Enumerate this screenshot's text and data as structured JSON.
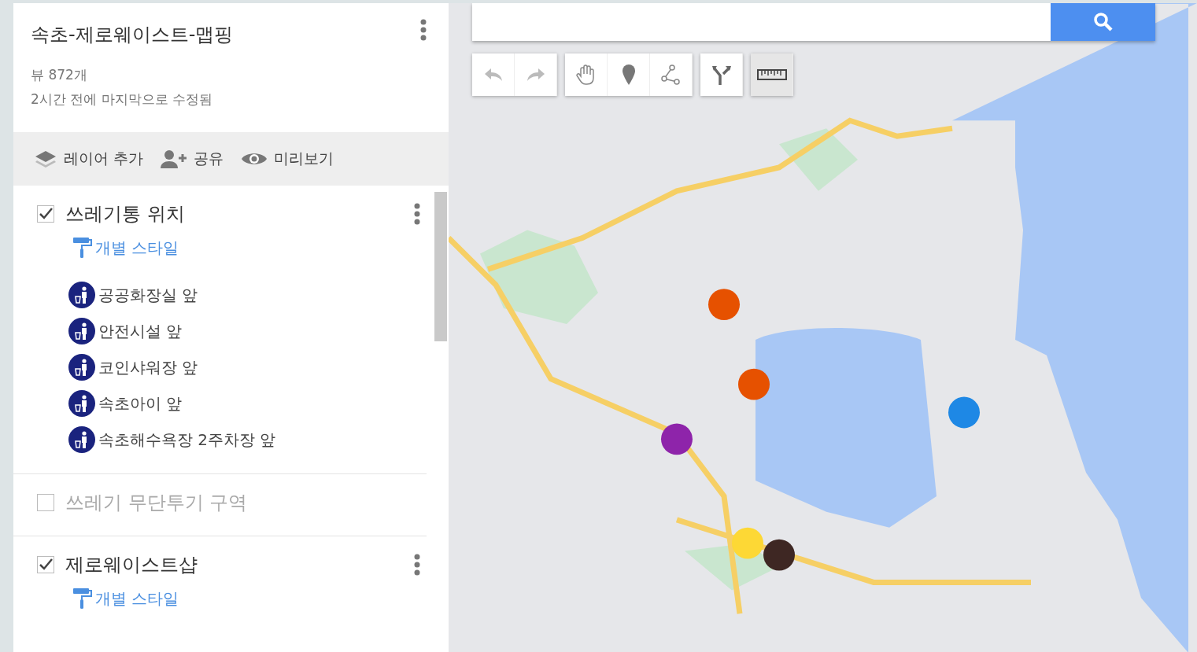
{
  "map_title": "속초-제로웨이스트-맵핑",
  "views": "뷰 872개",
  "modified": "2시간 전에 마지막으로 수정됨",
  "actions": [
    {
      "kind": "layers",
      "label": "레이어 추가"
    },
    {
      "kind": "share",
      "label": "공유"
    },
    {
      "kind": "preview",
      "label": "미리보기"
    }
  ],
  "layers": [
    {
      "name": "쓰레기통 위치",
      "checked": true,
      "style_link": "개별 스타일",
      "items": [
        "공공화장실 앞",
        "안전시설 앞",
        "코인샤워장 앞",
        "속초아이 앞",
        "속초해수욕장 2주차장 앞"
      ]
    },
    {
      "name": "쓰레기 무단투기 구역",
      "checked": false
    },
    {
      "name": "제로웨이스트샵",
      "checked": true,
      "style_link": "개별 스타일"
    }
  ],
  "map_tools": [
    [
      {
        "kind": "undo",
        "selected": false
      },
      {
        "kind": "redo",
        "selected": false
      }
    ],
    [
      {
        "kind": "hand",
        "selected": false
      },
      {
        "kind": "marker",
        "selected": false
      },
      {
        "kind": "line",
        "selected": false
      }
    ],
    [
      {
        "kind": "route",
        "selected": false
      }
    ],
    [
      {
        "kind": "ruler",
        "selected": true
      }
    ]
  ]
}
